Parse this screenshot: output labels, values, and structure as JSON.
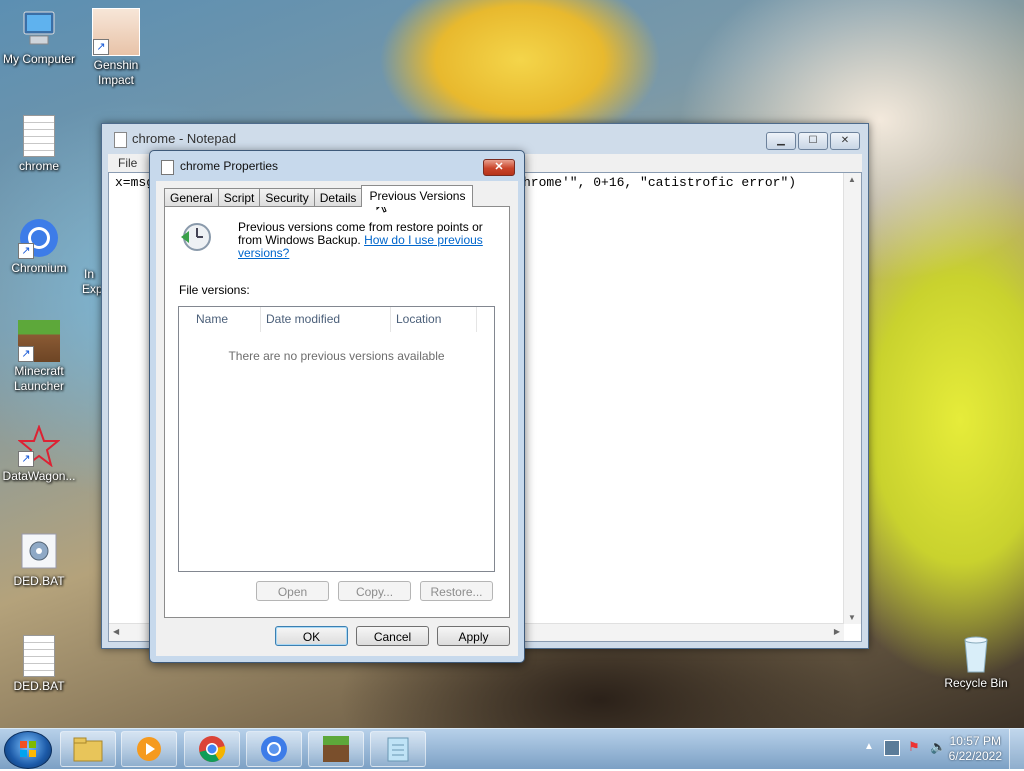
{
  "desktop": {
    "icons": [
      {
        "label": "My Computer"
      },
      {
        "label": "Genshin Impact"
      },
      {
        "label": "chrome"
      },
      {
        "label": "Chromium"
      },
      {
        "label": "Minecraft Launcher"
      },
      {
        "label": "DataWagon..."
      },
      {
        "label": "DED.BAT"
      },
      {
        "label": "DED.BAT"
      },
      {
        "label": "Recycle Bin"
      }
    ],
    "partial_labels": [
      "C",
      "G",
      "In",
      "Exp"
    ]
  },
  "notepad": {
    "title": "chrome - Notepad",
    "menu": [
      "File"
    ],
    "text_left": "x=msg",
    "text_right": "hrome'\", 0+16, \"catistrofic error\")"
  },
  "dialog": {
    "title": "chrome Properties",
    "close_glyph": "✕",
    "tabs": [
      "General",
      "Script",
      "Security",
      "Details",
      "Previous Versions"
    ],
    "active_tab": "Previous Versions",
    "info_text": "Previous versions come from restore points or from Windows Backup.",
    "help_link": "How do I use previous versions?",
    "file_versions_label": "File versions:",
    "columns": [
      "Name",
      "Date modified",
      "Location"
    ],
    "empty_message": "There are no previous versions available",
    "panel_buttons": {
      "open": "Open",
      "copy": "Copy...",
      "restore": "Restore..."
    },
    "footer_buttons": {
      "ok": "OK",
      "cancel": "Cancel",
      "apply": "Apply"
    }
  },
  "taskbar": {
    "items": [
      "windows-explorer",
      "media-player",
      "chrome",
      "chromium",
      "minecraft",
      "notepad"
    ],
    "clock": {
      "time": "10:57 PM",
      "date": "6/22/2022"
    }
  },
  "colors": {
    "titlebar": "#c7d9ec",
    "link": "#0066cc",
    "close_button": "#c9452b",
    "taskbar": "#7fa6cc"
  }
}
